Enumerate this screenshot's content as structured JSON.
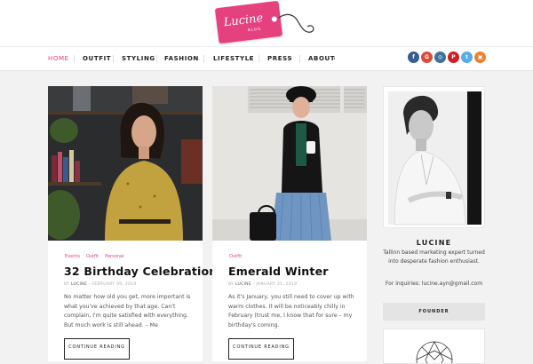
{
  "brand": {
    "logo_text": "Lucine",
    "logo_sub": "BLOG"
  },
  "nav": {
    "items": [
      "HOME",
      "OUTFIT",
      "STYLING",
      "FASHION",
      "LIFESTYLE",
      "PRESS",
      "ABOUT"
    ]
  },
  "social": {
    "icons": [
      "f",
      "G",
      "◎",
      "P",
      "t",
      "▣"
    ],
    "colors": [
      "#3b5998",
      "#dd4b39",
      "#3f729b",
      "#cb2027",
      "#55acee",
      "#ee802f"
    ]
  },
  "posts": [
    {
      "tags": [
        "Events",
        "Outfit",
        "Personal"
      ],
      "title": "32 Birthday Celebration",
      "meta_by": "BY",
      "author": "LUCINE",
      "date": " - FEBRUARY 09, 2019",
      "excerpt": "No matter how old you get, more important is what you've achieved by that age. Can't complain, I'm quite satisfied with everything. But much work is still ahead. – Me",
      "button": "CONTINUE READING"
    },
    {
      "tags": [
        "Outfit"
      ],
      "title": "Emerald Winter",
      "meta_by": "BY",
      "author": "LUCINE",
      "date": " - JANUARY 31, 2019",
      "excerpt": "As it's January, you still need to cover up with warm clothes. It will be noticeably chilly in February (trust me, I know that for sure – my birthday's coming.",
      "button": "CONTINUE READING"
    }
  ],
  "sidebar": {
    "name": "LUCINE",
    "bio": "Tallinn based marketing expert turned into desperate fashion enthusiast.",
    "inquiries": "For inquiries: lucine.ayn@gmail.com",
    "founder_label": "FOUNDER"
  },
  "colors": {
    "accent": "#e5417f"
  }
}
